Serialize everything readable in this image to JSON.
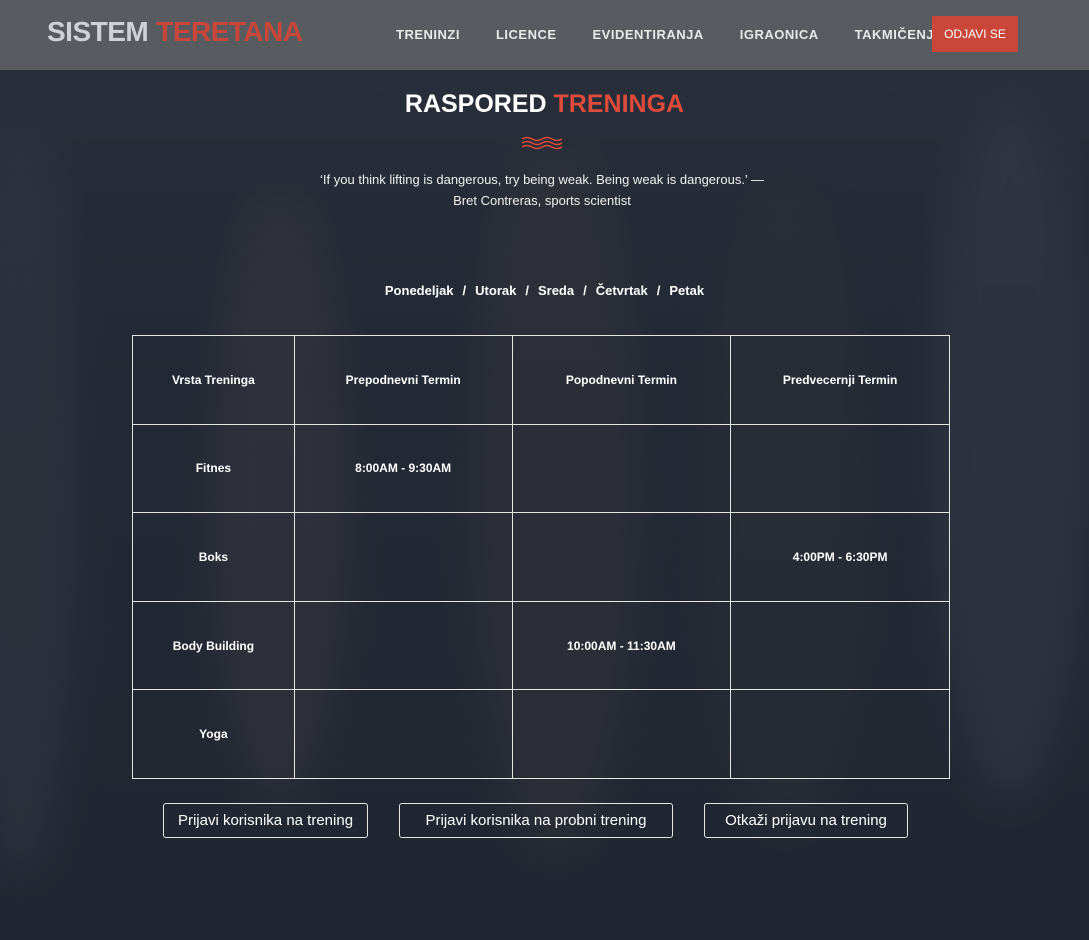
{
  "brand": {
    "part1": "SISTEM",
    "part2": "TERETANA"
  },
  "nav": {
    "items": [
      "TRENINZI",
      "LICENCE",
      "EVIDENTIRANJA",
      "IGRAONICA",
      "TAKMIČENJA"
    ],
    "logout_label": "ODJAVI SE"
  },
  "page": {
    "title_part1": "RASPORED",
    "title_part2": "TRENINGA",
    "quote": "‘If you think lifting is dangerous, try being weak. Being weak is dangerous.’ — Bret Contreras, sports scientist"
  },
  "days": [
    "Ponedeljak",
    "Utorak",
    "Sreda",
    "Četvrtak",
    "Petak"
  ],
  "schedule": {
    "headers": [
      "Vrsta Treninga",
      "Prepodnevni Termin",
      "Popodnevni Termin",
      "Predvecernji Termin"
    ],
    "rows": [
      [
        "Fitnes",
        "8:00AM - 9:30AM",
        "",
        ""
      ],
      [
        "Boks",
        "",
        "",
        "4:00PM - 6:30PM"
      ],
      [
        "Body Building",
        "",
        "10:00AM - 11:30AM",
        ""
      ],
      [
        "Yoga",
        "",
        "",
        ""
      ]
    ]
  },
  "actions": {
    "enroll": "Prijavi korisnika na trening",
    "trial": "Prijavi korisnika na probni trening",
    "cancel": "Otkaži prijavu na trening"
  },
  "colors": {
    "accent": "#dc4b3c",
    "header_bg": "#5c5f64"
  }
}
